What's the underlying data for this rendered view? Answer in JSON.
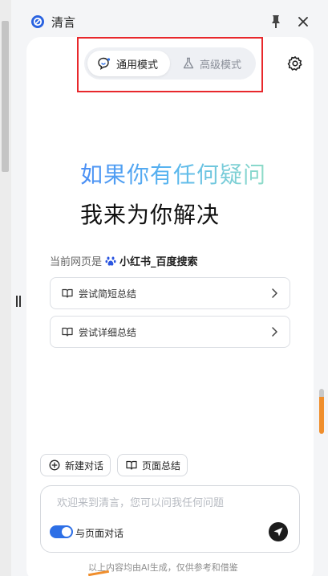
{
  "header": {
    "title": "清言"
  },
  "modes": {
    "general": "通用模式",
    "advanced": "高级模式"
  },
  "hero": {
    "line1": "如果你有任何疑问",
    "line2": "我来为你解决"
  },
  "current_page": {
    "prefix": "当前网页是",
    "name": "小红书_百度搜索"
  },
  "actions": [
    {
      "label": "尝试简短总结"
    },
    {
      "label": "尝试详细总结"
    }
  ],
  "chips": {
    "new_chat": "新建对话",
    "page_summary": "页面总结"
  },
  "input": {
    "placeholder": "欢迎来到清言，您可以问我任何问题",
    "value": ""
  },
  "page_chat_toggle": {
    "label": "与页面对话",
    "on": true
  },
  "footer": {
    "note": "以上内容均由AI生成，仅供参考和借鉴"
  },
  "colors": {
    "accent": "#2d6fe6",
    "highlight": "#e8282c",
    "scroll_thumb": "#f08e2c"
  }
}
